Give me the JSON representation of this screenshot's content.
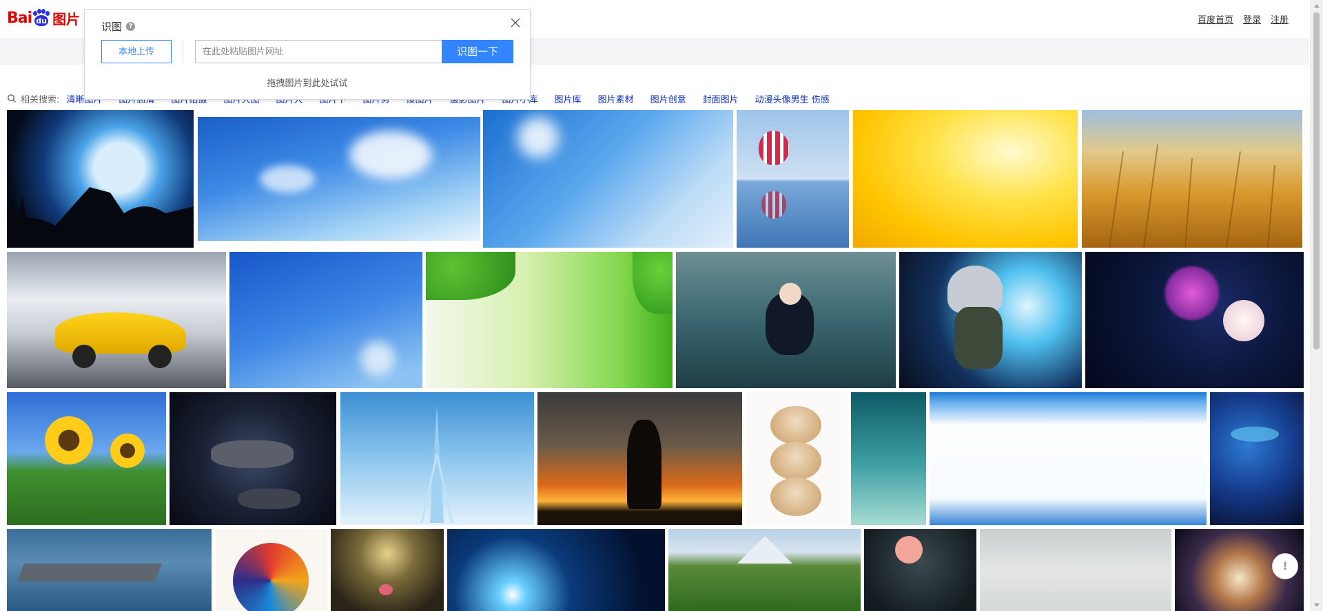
{
  "header": {
    "logo": {
      "bai": "Bai",
      "du": "du",
      "tu": "图片"
    },
    "links": [
      "百度首页",
      "登录",
      "注册"
    ]
  },
  "popup": {
    "title": "识图",
    "help_icon": "question-icon",
    "upload_label": "本地上传",
    "url_placeholder": "在此处粘贴图片网址",
    "search_label": "识图一下",
    "drag_hint": "拖拽图片到此处试试",
    "close_icon": "close-icon"
  },
  "related": {
    "label": "相关搜索:",
    "search_icon": "search-icon",
    "items": [
      "清晰图片",
      "图片高清",
      "图片拍摄",
      "图片大图",
      "图片大",
      "图片下",
      "图片男",
      "接图片",
      "摄影图片",
      "图片小库",
      "图片库",
      "图片素材",
      "图片创意",
      "封面图片",
      "动漫头像男生 伤感"
    ]
  },
  "feedback": {
    "label": "!",
    "icon": "feedback-icon"
  },
  "tiles": [
    {
      "name": "wolf-moon-night"
    },
    {
      "name": "blue-sky-clouds"
    },
    {
      "name": "blue-flowers-fantasy"
    },
    {
      "name": "hot-air-balloon"
    },
    {
      "name": "yellow-abstract"
    },
    {
      "name": "wheat-field"
    },
    {
      "name": "yellow-sports-car"
    },
    {
      "name": "sky-birds"
    },
    {
      "name": "green-leaves"
    },
    {
      "name": "anime-underwater-girl"
    },
    {
      "name": "kakashi-lightning"
    },
    {
      "name": "moon-night-flowers"
    },
    {
      "name": "sunflowers"
    },
    {
      "name": "spaceships"
    },
    {
      "name": "eiffel-tower-map"
    },
    {
      "name": "soldier-sunset"
    },
    {
      "name": "hamsters"
    },
    {
      "name": "danxie-text"
    },
    {
      "name": "blue-frame"
    },
    {
      "name": "whale-space"
    },
    {
      "name": "aircraft-carrier"
    },
    {
      "name": "face-collage"
    },
    {
      "name": "rose-lamp"
    },
    {
      "name": "space-planet"
    },
    {
      "name": "mountain-tea-field"
    },
    {
      "name": "rose-vase"
    },
    {
      "name": "ink-painting"
    },
    {
      "name": "galaxy-swirl"
    }
  ]
}
